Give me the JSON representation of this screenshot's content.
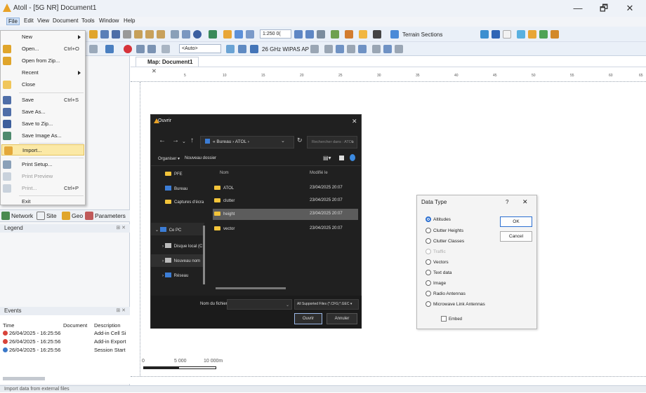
{
  "window": {
    "title": "Atoll - [5G NR] Document1",
    "min": "—",
    "max": "🗗",
    "close": "✕"
  },
  "menubar": [
    "File",
    "Edit",
    "View",
    "Document",
    "Tools",
    "Window",
    "Help"
  ],
  "file_menu": {
    "items": [
      {
        "label": "New",
        "shortcut": "",
        "sub": true
      },
      {
        "label": "Open...",
        "shortcut": "Ctrl+O"
      },
      {
        "label": "Open from Zip...",
        "shortcut": ""
      },
      {
        "label": "Recent",
        "shortcut": "",
        "sub": true
      },
      {
        "label": "Close",
        "shortcut": ""
      },
      {
        "label": "Save",
        "shortcut": "Ctrl+S"
      },
      {
        "label": "Save As...",
        "shortcut": ""
      },
      {
        "label": "Save to Zip...",
        "shortcut": ""
      },
      {
        "label": "Save Image As...",
        "shortcut": ""
      },
      {
        "label": "Import...",
        "shortcut": "",
        "highlighted": true
      },
      {
        "label": "Print Setup...",
        "shortcut": ""
      },
      {
        "label": "Print Preview",
        "shortcut": "",
        "disabled": true
      },
      {
        "label": "Print...",
        "shortcut": "Ctrl+P",
        "disabled": true
      },
      {
        "label": "Exit",
        "shortcut": ""
      }
    ]
  },
  "toolbar": {
    "scale": "1:250 0(",
    "combo": "<Auto>",
    "radio": "26 GHz WIPAS AP",
    "terrain": "Terrain Sections"
  },
  "explorer_tabs": [
    "Network",
    "Site",
    "Geo",
    "Parameters"
  ],
  "legend_title": "Legend",
  "events": {
    "title": "Events",
    "headers": [
      "Time",
      "Document",
      "Description"
    ],
    "rows": [
      {
        "type": "error",
        "time": "26/04/2025 - 16:25:56",
        "desc": "Add-in Cell Si"
      },
      {
        "type": "error",
        "time": "26/04/2025 - 16:25:56",
        "desc": "Add-in Export"
      },
      {
        "type": "info",
        "time": "26/04/2025 - 16:25:56",
        "desc": "Session Start"
      }
    ]
  },
  "status": "Import data from external files",
  "map": {
    "tab": "Map: Document1",
    "scale": [
      "0",
      "5 000",
      "10 000m"
    ],
    "ruler_top": [
      "5",
      "10",
      "15",
      "20",
      "25",
      "30",
      "35",
      "40",
      "45",
      "50",
      "55",
      "60",
      "65"
    ]
  },
  "open_dialog": {
    "title": "Ouvrir",
    "path": "« Bureau › ATOL ›",
    "search": "Rechercher dans : ATOL",
    "organize": "Organiser ▾",
    "new_folder": "Nouveau dossier",
    "col_name": "Nom",
    "col_date": "Modifié le",
    "nav": [
      "PFE",
      "Bureau",
      "Captures d'écra",
      "Ce PC",
      "Disque local (C",
      "Nouveau nom",
      "Réseau"
    ],
    "files": [
      {
        "name": "ATOL",
        "date": "23/04/2025 20:07"
      },
      {
        "name": "clutter",
        "date": "23/04/2025 20:07"
      },
      {
        "name": "height",
        "date": "23/04/2025 20:07",
        "selected": true
      },
      {
        "name": "vector",
        "date": "23/04/2025 20:07"
      }
    ],
    "filename_label": "Nom du fichier :",
    "filter": "All Supported Files (*.CFG;*.GEC ▾",
    "open": "Ouvrir",
    "cancel": "Annuler"
  },
  "data_type": {
    "title": "Data Type",
    "help": "?",
    "close": "✕",
    "options": [
      {
        "label": "Altitudes",
        "checked": true
      },
      {
        "label": "Clutter Heights"
      },
      {
        "label": "Clutter Classes"
      },
      {
        "label": "Traffic",
        "disabled": true
      },
      {
        "label": "Vectors"
      },
      {
        "label": "Text data"
      },
      {
        "label": "Image"
      },
      {
        "label": "Radio Antennas"
      },
      {
        "label": "Microwave Link Antennas"
      }
    ],
    "ok": "OK",
    "cancel": "Cancel",
    "embed": "Embed"
  }
}
